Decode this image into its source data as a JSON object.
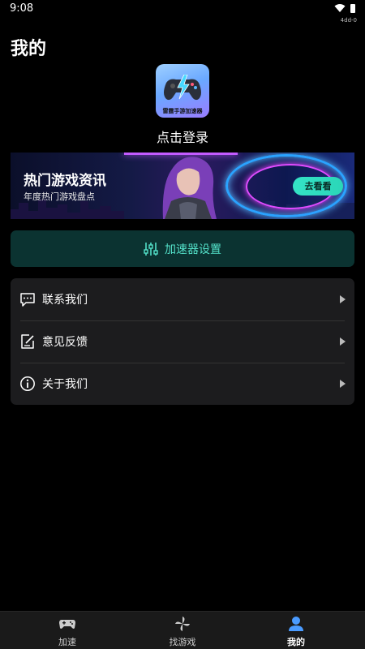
{
  "status": {
    "time": "9:08",
    "code": "4dd-0"
  },
  "page": {
    "title": "我的"
  },
  "profile": {
    "logo_text": "雷霆手游加速器",
    "login_label": "点击登录"
  },
  "banner": {
    "title": "热门游戏资讯",
    "subtitle": "年度热门游戏盘点",
    "button": "去看看"
  },
  "settings": {
    "label": "加速器设置"
  },
  "menu": {
    "items": [
      {
        "label": "联系我们",
        "icon": "message-icon"
      },
      {
        "label": "意见反馈",
        "icon": "feedback-icon"
      },
      {
        "label": "关于我们",
        "icon": "info-icon"
      }
    ]
  },
  "tabs": [
    {
      "label": "加速",
      "icon": "gamepad-icon",
      "active": false
    },
    {
      "label": "找游戏",
      "icon": "pinwheel-icon",
      "active": false
    },
    {
      "label": "我的",
      "icon": "user-icon",
      "active": true
    }
  ],
  "colors": {
    "accent": "#53e0c8",
    "tab_active": "#4a9bff",
    "card": "#1c1c1e",
    "settings_bg": "#0b3331"
  }
}
